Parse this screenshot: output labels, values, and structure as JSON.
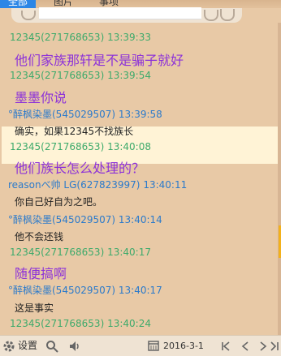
{
  "tabs": [
    {
      "label": "全部",
      "active": true
    },
    {
      "label": "图片",
      "active": false
    },
    {
      "label": "事项",
      "active": false
    }
  ],
  "search": {
    "placeholder": ""
  },
  "messages": [
    {
      "sender": "12345(271768653)",
      "time": "13:39:33",
      "text": "他们家族那轩是不是骗子就好",
      "style": "big"
    },
    {
      "sender": "12345(271768653)",
      "time": "13:39:54",
      "text": "墨墨你说",
      "style": "big"
    },
    {
      "sender": "°醉枫染墨(545029507)",
      "time": "13:39:58",
      "text": "确实，如果12345不找族长",
      "style": "small",
      "highlight": true
    },
    {
      "sender": "12345(271768653)",
      "time": "13:40:08",
      "text": "他们族长怎么处理的？",
      "style": "big"
    },
    {
      "sender": "reasonべ帅 LG(627823997)",
      "time": "13:40:11",
      "text": "你自己好自为之吧。",
      "style": "small"
    },
    {
      "sender": "°醉枫染墨(545029507)",
      "time": "13:40:14",
      "text": "他不会还钱",
      "style": "small"
    },
    {
      "sender": "12345(271768653)",
      "time": "13:40:17",
      "text": "随便搞啊",
      "style": "big"
    },
    {
      "sender": "°醉枫染墨(545029507)",
      "time": "13:40:17",
      "text": "这是事实",
      "style": "small"
    },
    {
      "sender": "12345(271768653)",
      "time": "13:40:24",
      "text": "",
      "style": "none"
    }
  ],
  "bottom": {
    "settings_label": "设置",
    "date": "2016-3-1"
  },
  "colors": {
    "background": "#e8c9a6",
    "tab_active": "#2b86e6",
    "sender_green": "#3daa6b",
    "sender_blue": "#2b7acb",
    "big_text_purple": "#8d32d8",
    "highlight": "#fff3d6",
    "scroll_thumb": "#f3b11b"
  },
  "icons": [
    "gear-icon",
    "search-icon",
    "speaker-icon",
    "calendar-icon",
    "first-page-icon",
    "prev-page-icon",
    "next-page-icon",
    "last-page-icon"
  ]
}
